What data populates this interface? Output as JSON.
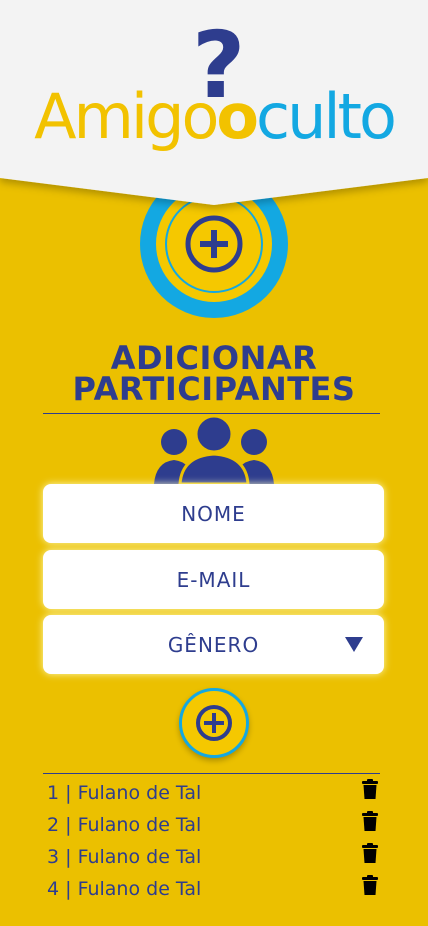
{
  "app": {
    "logo_part1": "Amigo",
    "logo_part2": "culto",
    "logo_symbol": "?"
  },
  "section": {
    "title_line1": "ADICIONAR",
    "title_line2": "PARTICIPANTES"
  },
  "form": {
    "name_label": "NOME",
    "email_label": "E-MAIL",
    "gender_label": "GÊNERO"
  },
  "participants": [
    {
      "label": "1 | Fulano de Tal"
    },
    {
      "label": "2 | Fulano de Tal"
    },
    {
      "label": "3 | Fulano de Tal"
    },
    {
      "label": "4 | Fulano de Tal"
    }
  ],
  "icons": {
    "target": "target-plus-icon",
    "people": "people-group-icon",
    "add": "plus-circle-icon",
    "delete": "trash-icon",
    "dropdown": "caret-down-icon"
  },
  "colors": {
    "background": "#ebc000",
    "navy": "#2e3d8e",
    "cyan": "#13a8e2",
    "header": "#f3f3f3"
  }
}
